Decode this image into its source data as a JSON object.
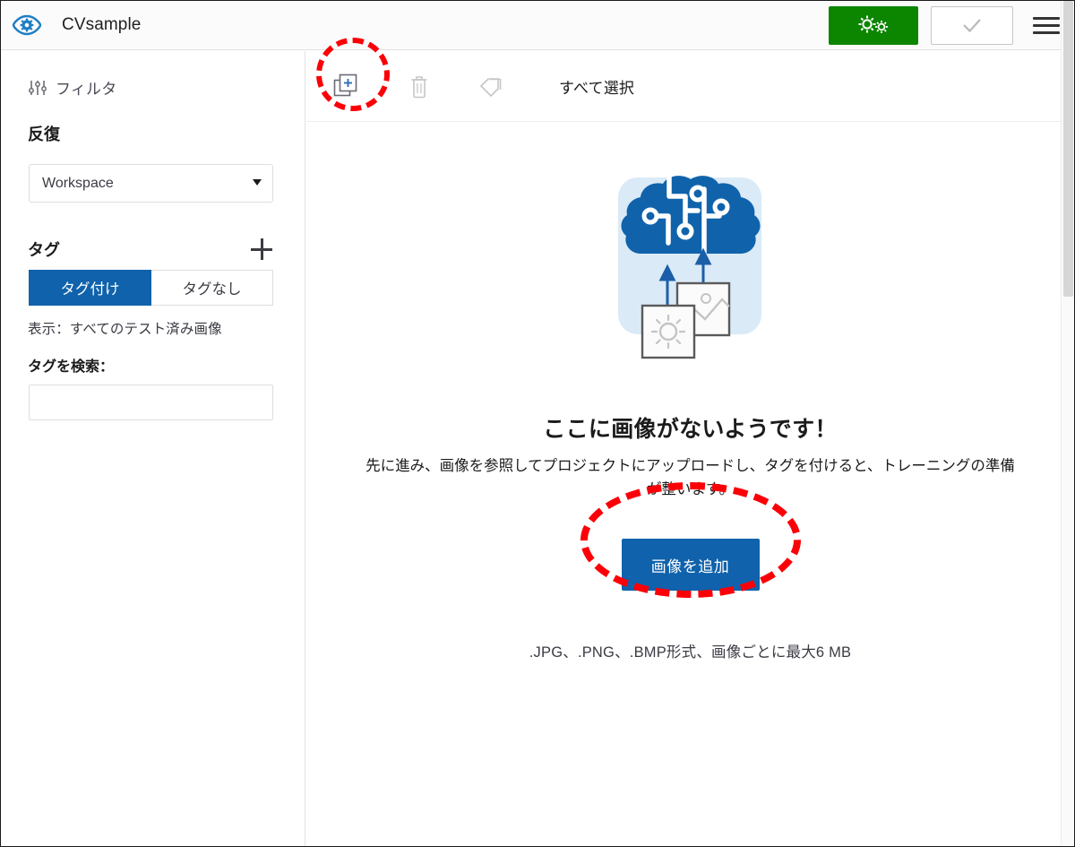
{
  "header": {
    "logo_icon": "eye-gear-logo-icon",
    "title": "CVsample",
    "train_button": {
      "icon": "dual-gear-icon",
      "label": ""
    },
    "quick_test_button": {
      "icon": "checkmark-icon",
      "label": ""
    },
    "menu_button": {
      "icon": "hamburger-menu-icon",
      "label": ""
    }
  },
  "sidebar": {
    "filter": {
      "icon": "sliders-filter-icon",
      "label": "フィルタ"
    },
    "iteration": {
      "heading": "反復",
      "select_value": "Workspace",
      "caret_icon": "chevron-down-icon"
    },
    "tags": {
      "heading": "タグ",
      "add_icon": "plus-icon",
      "segments": [
        {
          "label": "タグ付け",
          "active": true
        },
        {
          "label": "タグなし",
          "active": false
        }
      ],
      "display_note": "表示：すべてのテスト済み画像",
      "search_label": "タグを検索：",
      "search_value": "",
      "search_placeholder": ""
    }
  },
  "toolbar": {
    "add_image_icon": "add-image-icon",
    "delete_icon": "trash-icon",
    "tag_icon": "tag-icon",
    "select_all_label": "すべて選択"
  },
  "empty_state": {
    "illustration": "brain-upload-images-illustration",
    "title": "ここに画像がないようです！",
    "subtitle": "先に進み、画像を参照してプロジェクトにアップロードし、タグを付けると、トレーニングの準備が整います。",
    "add_button_label": "画像を追加",
    "formats_note": ".JPG、.PNG、.BMP形式、画像ごとに最大6 MB"
  },
  "annotations": {
    "highlight_color": "#fb0007",
    "circle_target": "add-image-icon",
    "ellipse_target": "add-images-button"
  },
  "colors": {
    "brand_blue": "#0f62ab",
    "train_green": "#0c8500",
    "accent_red": "#fb0007",
    "illustration_bg": "#daeaf7",
    "illustration_blue": "#1063ab"
  }
}
